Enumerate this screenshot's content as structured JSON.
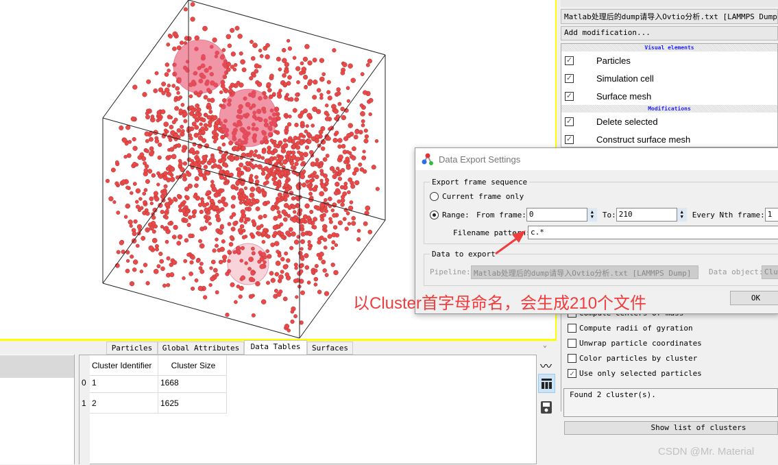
{
  "viewport": {
    "particle_color": "#e84a4a",
    "sphere_color": "#e8506a",
    "border_color": "#ffff00"
  },
  "pipeline": {
    "source": "Matlab处理后的dump请导入Ovtio分析.txt [LAMMPS Dump]",
    "add_modification": "Add modification...",
    "sections": [
      {
        "header": "Visual elements",
        "items": [
          {
            "label": "Particles",
            "checked": true
          },
          {
            "label": "Simulation cell",
            "checked": true
          },
          {
            "label": "Surface mesh",
            "checked": true
          }
        ]
      },
      {
        "header": "Modifications",
        "items": [
          {
            "label": "Delete selected",
            "checked": true
          },
          {
            "label": "Construct surface mesh",
            "checked": true
          }
        ]
      }
    ]
  },
  "cluster_options": [
    {
      "label": "Compute centers of mass",
      "checked": false
    },
    {
      "label": "Compute radii of gyration",
      "checked": false
    },
    {
      "label": "Unwrap particle coordinates",
      "checked": false
    },
    {
      "label": "Color particles by cluster",
      "checked": false
    },
    {
      "label": "Use only selected particles",
      "checked": true
    }
  ],
  "status": "Found 2 cluster(s).",
  "show_list_button": "Show list of clusters",
  "dialog": {
    "title": "Data Export Settings",
    "frame_group": "Export frame sequence",
    "current_frame_only": "Current frame only",
    "range_label": "Range:",
    "from_label": "From frame:",
    "from_value": "0",
    "to_label": "To:",
    "to_value": "210",
    "nth_label": "Every Nth frame:",
    "nth_value": "1",
    "filename_label": "Filename pattern:",
    "filename_value": "c.*",
    "data_group": "Data to export",
    "pipeline_label": "Pipeline:",
    "pipeline_value": "Matlab处理后的dump请导入Ovtio分析.txt [LAMMPS Dump]",
    "data_object_label": "Data object:",
    "data_object_value": "Clu",
    "ok": "OK",
    "selected_mode": "range"
  },
  "annotation": {
    "text": "以Cluster首字母命名，会生成210个文件",
    "color": "#f03c3c"
  },
  "bottom": {
    "tabs": [
      "Particles",
      "Global Attributes",
      "Data Tables",
      "Surfaces"
    ],
    "active_tab": "Data Tables",
    "table": {
      "columns": [
        "Cluster Identifier",
        "Cluster Size"
      ],
      "row_headers": [
        "0",
        "1"
      ],
      "rows": [
        [
          "1",
          "1668"
        ],
        [
          "2",
          "1625"
        ]
      ]
    }
  },
  "watermark": "CSDN @Mr. Material"
}
